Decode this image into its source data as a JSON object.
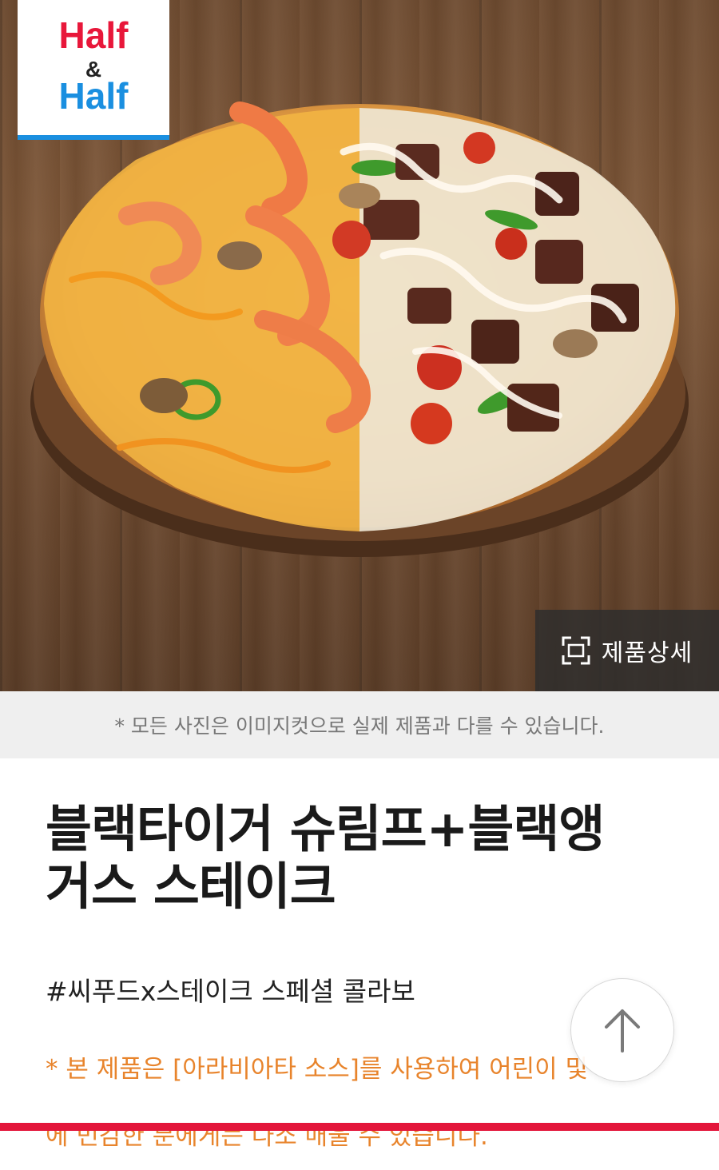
{
  "logo": {
    "line1": "Half",
    "ampersand": "&",
    "line2": "Half",
    "color_top": "#e8173a",
    "color_bottom": "#1a8fe0"
  },
  "hero": {
    "detail_label": "제품상세",
    "detail_icon": "expand-icon"
  },
  "notice": "* 모든 사진은 이미지컷으로 실제 제품과 다를 수 있습니다.",
  "product": {
    "title_line1": "블랙타이거 슈림프+블랙앵",
    "title_line2": "거스 스테이크",
    "hashtag": "#씨푸드x스테이크 스페셜 콜라보",
    "warning_line1": "* 본 제품은 [아라비아타 소스]를 사용하여 어린이 및",
    "warning_line2": "에 민감한 분에게는 다소 매울 수 있습니다."
  },
  "scroll_top": {
    "icon": "arrow-up-icon"
  },
  "colors": {
    "accent_red": "#e3153a",
    "warning_orange": "#e8842c",
    "notice_bg": "#efefef"
  }
}
